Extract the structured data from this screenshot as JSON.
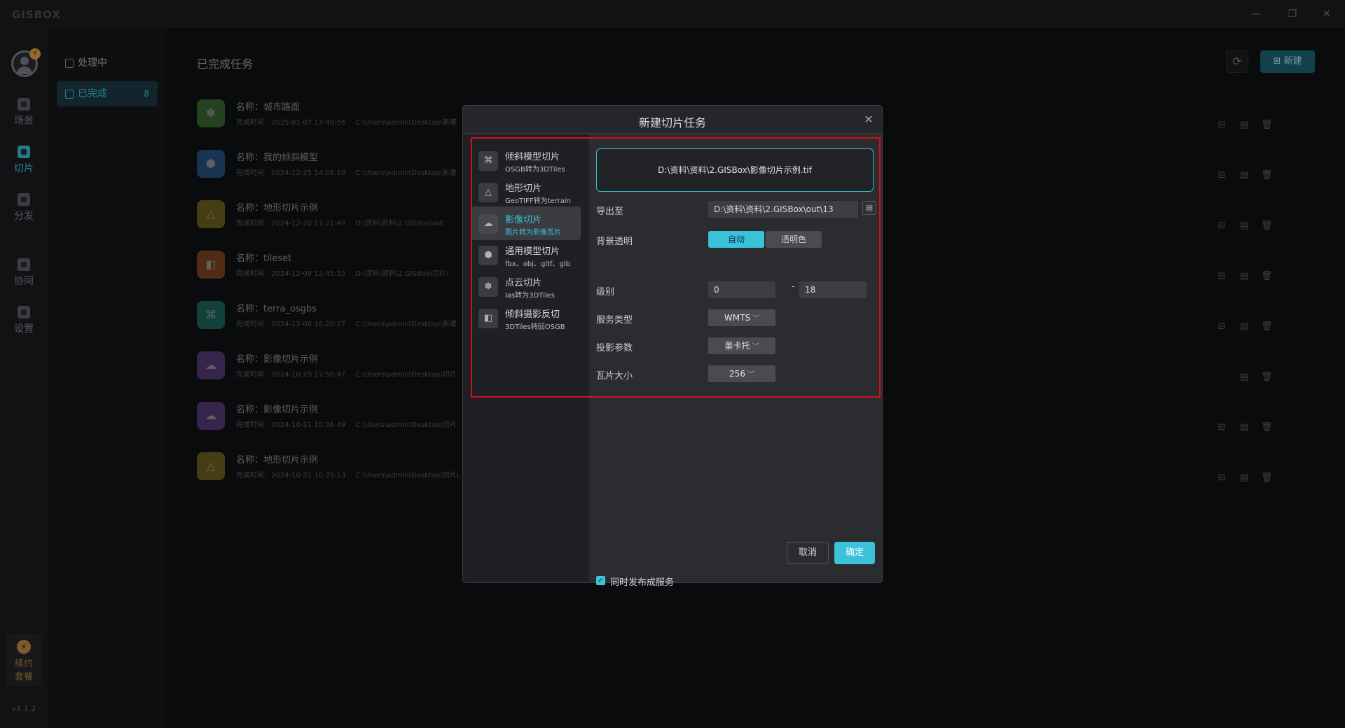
{
  "app": {
    "logo": "GISBOX",
    "version": "v1.1.2",
    "window_controls": {
      "minimize": "—",
      "restore": "❐",
      "close": "✕"
    }
  },
  "rail": {
    "avatar_badge": "⚡",
    "items": [
      {
        "label": "场景",
        "icon": "scene-icon"
      },
      {
        "label": "切片",
        "icon": "tile-icon"
      },
      {
        "label": "分发",
        "icon": "distribute-icon"
      },
      {
        "label": "协同",
        "icon": "collaborate-icon"
      },
      {
        "label": "设置",
        "icon": "settings-icon"
      }
    ],
    "plan_badge": "⚡",
    "plan_line1": "续约",
    "plan_line2": "套餐"
  },
  "side": {
    "items": [
      {
        "label": "处理中"
      },
      {
        "label": "已完成",
        "count": "8"
      }
    ]
  },
  "main": {
    "title": "已完成任务",
    "refresh_glyph": "⟳",
    "new_label": "新建",
    "new_glyph": "⊞",
    "tasks": [
      {
        "name": "名称：城市路面",
        "time": "完成时间：2025-01-07 13:40:56",
        "path": "C:\\Users\\admin\\Desktop\\新建",
        "color": "#5aa84c",
        "glyph": "✽"
      },
      {
        "name": "名称：我的倾斜模型",
        "time": "完成时间：2024-12-25 14:06:10",
        "path": "C:\\Users\\admin\\Desktop\\新建",
        "color": "#3a86d6",
        "glyph": "⬢"
      },
      {
        "name": "名称：地形切片示例",
        "time": "完成时间：2024-12-20 11:21:49",
        "path": "D:\\资料\\资料\\2.GISBox\\out",
        "color": "#b5a12d",
        "glyph": "△"
      },
      {
        "name": "名称：tileset",
        "time": "完成时间：2024-12-09 12:45:33",
        "path": "D:\\资料\\资料\\2.GISBox\\切片\\",
        "color": "#d86a32",
        "glyph": "◧"
      },
      {
        "name": "名称：terra_osgbs",
        "time": "完成时间：2024-12-06 16:20:27",
        "path": "C:\\Users\\admin\\Desktop\\新建",
        "color": "#27a99a",
        "glyph": "⌘"
      },
      {
        "name": "名称：影像切片示例",
        "time": "完成时间：2024-10-29 17:56:47",
        "path": "C:\\Users\\admin\\Desktop\\切片",
        "color": "#8f5ac4",
        "glyph": "☁"
      },
      {
        "name": "名称：影像切片示例",
        "time": "完成时间：2024-10-21 10:36:49",
        "path": "C:\\Users\\admin\\Desktop\\切片",
        "color": "#8f5ac4",
        "glyph": "☁"
      },
      {
        "name": "名称：地形切片示例",
        "time": "完成时间：2024-10-21 10:29:13",
        "path": "C:\\Users\\admin\\Desktop\\切片\\",
        "color": "#b5a12d",
        "glyph": "△"
      }
    ],
    "row_action_glyphs": {
      "publish": "⊟",
      "file": "▤",
      "delete": "🗑"
    }
  },
  "modal": {
    "title": "新建切片任务",
    "close_glyph": "✕",
    "types": [
      {
        "name": "倾斜模型切片",
        "sub": "OSGB转为3DTiles",
        "glyph": "⌘"
      },
      {
        "name": "地形切片",
        "sub": "GeoTIFF转为terrain",
        "glyph": "△"
      },
      {
        "name": "影像切片",
        "sub": "图片转为影像瓦片",
        "glyph": "☁"
      },
      {
        "name": "通用模型切片",
        "sub": "fbx、obj、gltf、glb",
        "glyph": "⬢"
      },
      {
        "name": "点云切片",
        "sub": "las转为3DTiles",
        "glyph": "✽"
      },
      {
        "name": "倾斜摄影反切",
        "sub": "3DTiles转回OSGB",
        "glyph": "◧"
      }
    ],
    "file_path": "D:\\资料\\资料\\2.GISBox\\影像切片示例.tif",
    "export_label": "导出至",
    "export_value": "D:\\资料\\资料\\2.GISBox\\out\\13",
    "browse_glyph": "▤",
    "bg_label": "背景透明",
    "bg_options": [
      "自动",
      "透明色"
    ],
    "level_label": "级别",
    "level_min": "0",
    "level_sep": "-",
    "level_max": "18",
    "service_label": "服务类型",
    "service_value": "WMTS",
    "projection_label": "投影参数",
    "projection_value": "墨卡托",
    "tilesize_label": "瓦片大小",
    "tilesize_value": "256",
    "chevron": "﹀",
    "publish_check_glyph": "✓",
    "publish_label": "同时发布成服务",
    "cancel_label": "取消",
    "ok_label": "确定"
  },
  "colors": {
    "accent": "#39c2da",
    "highlight_border": "#d4111b"
  }
}
